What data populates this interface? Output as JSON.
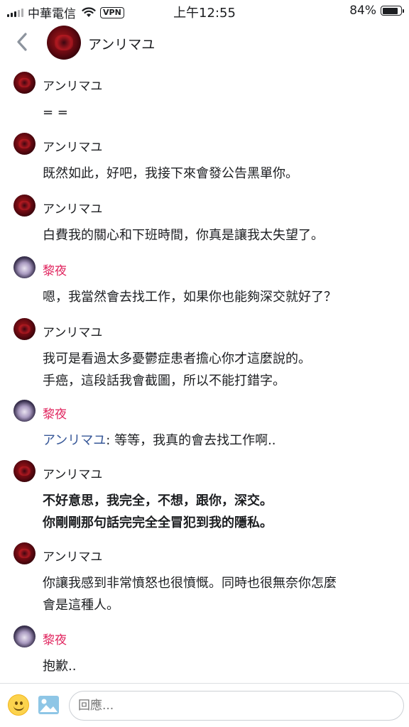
{
  "status": {
    "carrier": "中華電信",
    "vpn": "VPN",
    "time": "上午12:55",
    "battery": "84%",
    "battery_level": 0.84
  },
  "header": {
    "title": "アンリマユ"
  },
  "messages": [
    {
      "author": "アンリマユ",
      "avatar": "red",
      "lines": [
        "= ="
      ]
    },
    {
      "author": "アンリマユ",
      "avatar": "red",
      "lines": [
        "既然如此，好吧，我接下來會發公告黑單你。"
      ]
    },
    {
      "author": "アンリマユ",
      "avatar": "red",
      "lines": [
        "白費我的關心和下班時間，你真是讓我太失望了。"
      ]
    },
    {
      "author": "黎夜",
      "avatar": "purple",
      "lines": [
        "嗯，我當然會去找工作，如果你也能夠深交就好了？"
      ]
    },
    {
      "author": "アンリマユ",
      "avatar": "red",
      "lines": [
        "我可是看過太多憂鬱症患者擔心你才這麼說的。",
        "手癌，這段話我會截圖，所以不能打錯字。"
      ]
    },
    {
      "author": "黎夜",
      "avatar": "purple",
      "mention": "アンリマユ",
      "lines": [
        ": 等等，我真的會去找工作啊.."
      ]
    },
    {
      "author": "アンリマユ",
      "avatar": "red",
      "lines": [
        "不好意思，我完全，不想，跟你，深交。",
        "你剛剛那句話完完全全冒犯到我的隱私。"
      ],
      "bold": true
    },
    {
      "author": "アンリマユ",
      "avatar": "red",
      "lines": [
        "你讓我感到非常憤怒也很憤慨。同時也很無奈你怎麼",
        "會是這種人。"
      ]
    },
    {
      "author": "黎夜",
      "avatar": "purple",
      "lines": [
        "抱歉.."
      ]
    }
  ],
  "composer": {
    "placeholder": "回應..."
  },
  "icons": {
    "back": "chevron-left-icon",
    "emoji": "smiley-icon",
    "photo": "photo-icon"
  },
  "colors": {
    "accent_name": "#e0245e",
    "mention": "#385898",
    "back_chevron": "#8d949e",
    "photo_icon": "#8ec6e6"
  }
}
